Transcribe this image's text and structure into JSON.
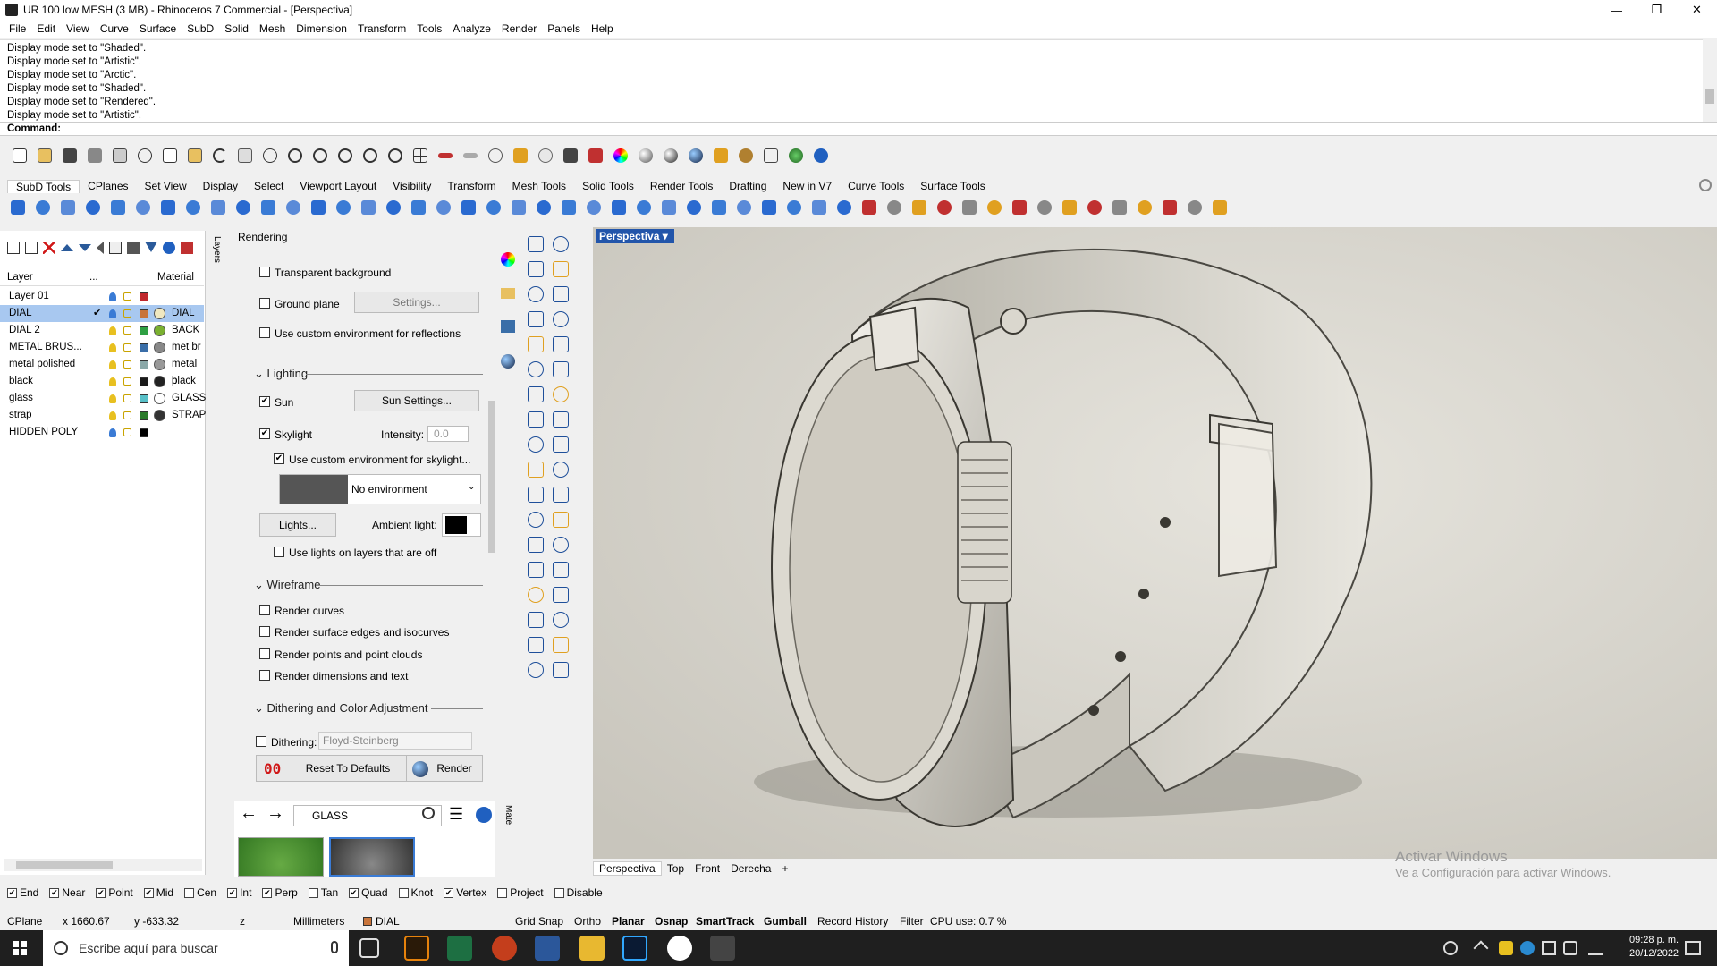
{
  "window": {
    "title": "UR 100 low MESH (3 MB) - Rhinoceros 7 Commercial - [Perspectiva]",
    "minimize": "—",
    "maximize": "❐",
    "close": "✕"
  },
  "menu": [
    "File",
    "Edit",
    "View",
    "Curve",
    "Surface",
    "SubD",
    "Solid",
    "Mesh",
    "Dimension",
    "Transform",
    "Tools",
    "Analyze",
    "Render",
    "Panels",
    "Help"
  ],
  "history": [
    "Display mode set to \"Shaded\".",
    "Display mode set to \"Artistic\".",
    "Display mode set to \"Arctic\".",
    "Display mode set to \"Shaded\".",
    "Display mode set to \"Rendered\".",
    "Display mode set to \"Artistic\"."
  ],
  "command_label": "Command:",
  "toolbar_tabs": [
    "SubD Tools",
    "CPlanes",
    "Set View",
    "Display",
    "Select",
    "Viewport Layout",
    "Visibility",
    "Transform",
    "Mesh Tools",
    "Solid Tools",
    "Render Tools",
    "Drafting",
    "New in V7",
    "Curve Tools",
    "Surface Tools"
  ],
  "layers_panel": {
    "col_layer": "Layer",
    "col_dots": "...",
    "col_material": "Material",
    "tab_label": "Layers",
    "rows": [
      {
        "name": "Layer 01",
        "color": "#c0282d",
        "bulb": "#3a7bd5",
        "material": "",
        "selected": false,
        "check": ""
      },
      {
        "name": "DIAL",
        "color": "#c8743a",
        "bulb": "#3a7bd5",
        "material": "DIAL",
        "mat_color": "#f0e8c0",
        "selected": true,
        "check": "✔"
      },
      {
        "name": "DIAL 2",
        "color": "#2ea043",
        "bulb": "#e8c020",
        "material": "BACK I",
        "mat_color": "#7ab030",
        "selected": false,
        "check": ""
      },
      {
        "name": "METAL BRUS...",
        "color": "#3a6ea8",
        "bulb": "#e8c020",
        "material": "met br",
        "mat_color": "#888888",
        "selected": false,
        "check": ""
      },
      {
        "name": "metal polished",
        "color": "#8aa8a8",
        "bulb": "#e8c020",
        "material": "metal p",
        "mat_color": "#999999",
        "selected": false,
        "check": ""
      },
      {
        "name": "black",
        "color": "#1a1a1a",
        "bulb": "#e8c020",
        "material": "black",
        "mat_color": "#222222",
        "selected": false,
        "check": ""
      },
      {
        "name": "glass",
        "color": "#58c0c8",
        "bulb": "#e8c020",
        "material": "GLASS",
        "mat_color": "#ffffff",
        "selected": false,
        "check": ""
      },
      {
        "name": "strap",
        "color": "#2a7a2a",
        "bulb": "#e8c020",
        "material": "STRAP",
        "mat_color": "#333333",
        "selected": false,
        "check": ""
      },
      {
        "name": "HIDDEN POLY",
        "color": "#000000",
        "bulb": "#3a7bd5",
        "material": "",
        "selected": false,
        "check": ""
      }
    ]
  },
  "rendering": {
    "title": "Rendering",
    "transparent_bg": "Transparent background",
    "ground_plane": "Ground plane",
    "settings_btn": "Settings...",
    "custom_env_reflections": "Use custom environment for reflections",
    "lighting": "Lighting",
    "sun": "Sun",
    "sun_settings": "Sun Settings...",
    "skylight": "Skylight",
    "intensity_label": "Intensity:",
    "intensity_value": "0.0",
    "custom_env_skylight": "Use custom environment for skylight...",
    "no_environment": "No environment",
    "lights_btn": "Lights...",
    "ambient_light": "Ambient light:",
    "lights_off_layers": "Use lights on layers that are off",
    "wireframe": "Wireframe",
    "render_curves": "Render curves",
    "render_edges": "Render surface edges and isocurves",
    "render_points": "Render points and point clouds",
    "render_dims": "Render dimensions and text",
    "dithering_section": "Dithering and Color Adjustment",
    "dithering": "Dithering:",
    "dithering_value": "Floyd-Steinberg",
    "reset_btn": "Reset To Defaults",
    "render_btn": "Render",
    "reset_icon_text": "00"
  },
  "materials": {
    "search_value": "GLASS",
    "tab_label": "Mate"
  },
  "viewport": {
    "active_label": "Perspectiva",
    "tabs": [
      "Perspectiva",
      "Top",
      "Front",
      "Derecha"
    ],
    "add_tab": "+",
    "watermark_1": "Activar Windows",
    "watermark_2": "Ve a Configuración para activar Windows."
  },
  "osnaps": [
    {
      "label": "End",
      "checked": true
    },
    {
      "label": "Near",
      "checked": true
    },
    {
      "label": "Point",
      "checked": true
    },
    {
      "label": "Mid",
      "checked": true
    },
    {
      "label": "Cen",
      "checked": false
    },
    {
      "label": "Int",
      "checked": true
    },
    {
      "label": "Perp",
      "checked": true
    },
    {
      "label": "Tan",
      "checked": false
    },
    {
      "label": "Quad",
      "checked": true
    },
    {
      "label": "Knot",
      "checked": false
    },
    {
      "label": "Vertex",
      "checked": true
    },
    {
      "label": "Project",
      "checked": false
    },
    {
      "label": "Disable",
      "checked": false
    }
  ],
  "status": {
    "cplane": "CPlane",
    "x": "x 1660.67",
    "y": "y -633.32",
    "z": "z",
    "units": "Millimeters",
    "layer": "DIAL",
    "grid_snap": "Grid Snap",
    "ortho": "Ortho",
    "planar": "Planar",
    "osnap": "Osnap",
    "smarttrack": "SmartTrack",
    "gumball": "Gumball",
    "record_history": "Record History",
    "filter": "Filter",
    "cpu": "CPU use: 0.7 %"
  },
  "taskbar": {
    "search_placeholder": "Escribe aquí para buscar",
    "time": "09:28 p. m.",
    "date": "20/12/2022"
  }
}
